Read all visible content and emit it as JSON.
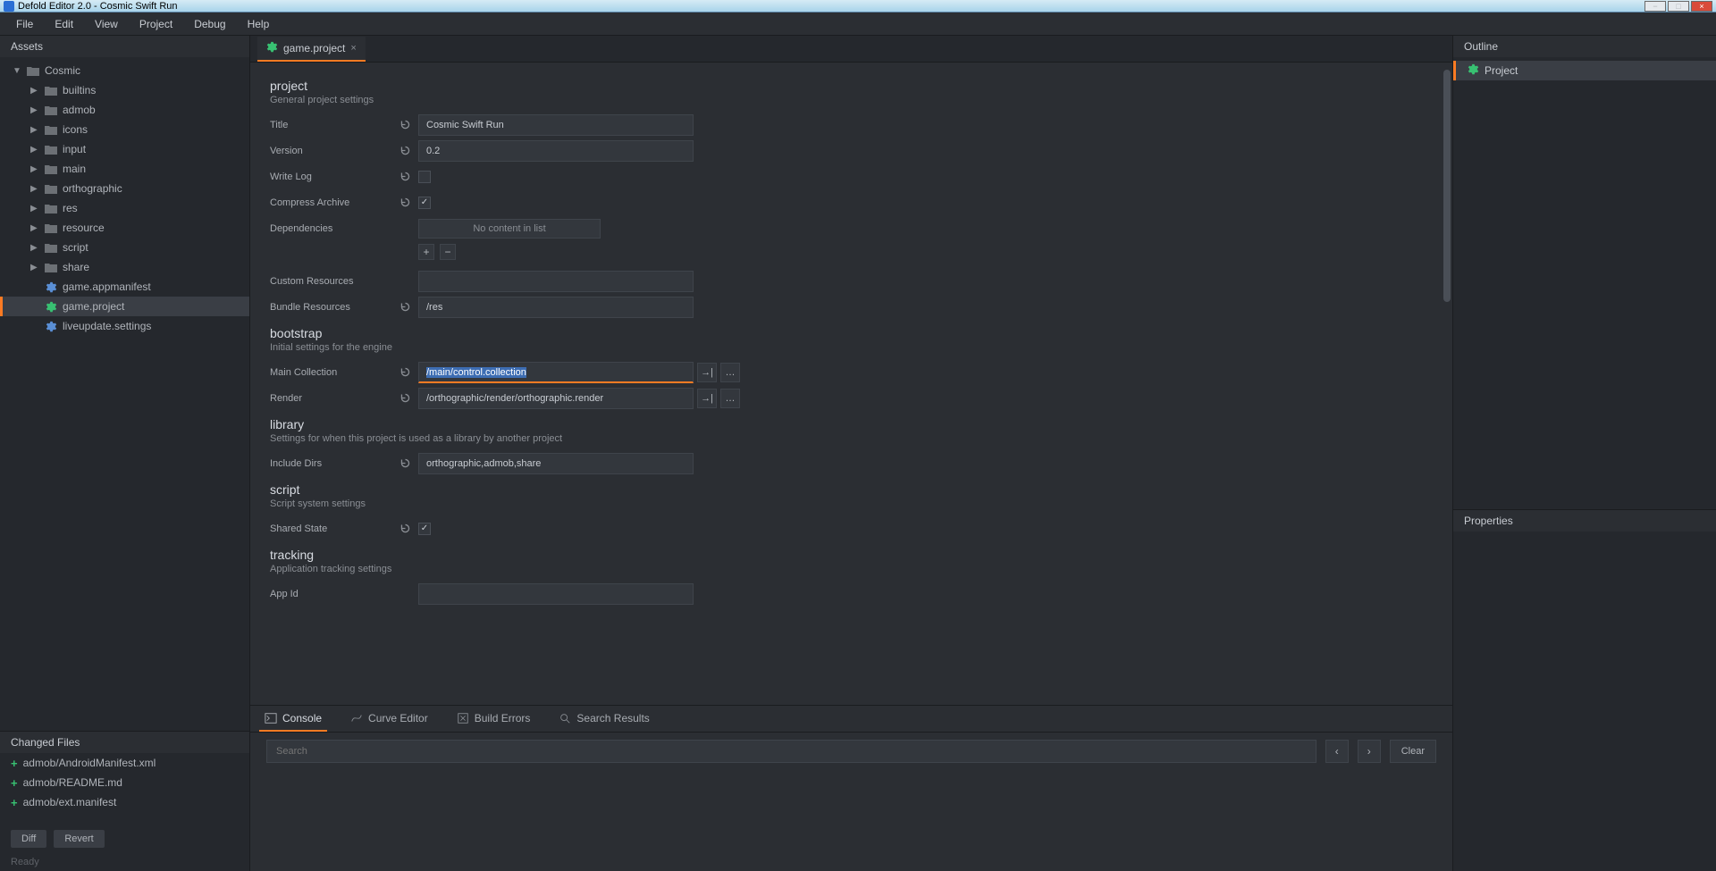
{
  "window": {
    "title": "Defold Editor 2.0 - Cosmic Swift Run",
    "minimize": "−",
    "maximize": "□",
    "close": "×"
  },
  "menubar": [
    "File",
    "Edit",
    "View",
    "Project",
    "Debug",
    "Help"
  ],
  "assets": {
    "header": "Assets",
    "root": "Cosmic",
    "folders": [
      "builtins",
      "admob",
      "icons",
      "input",
      "main",
      "orthographic",
      "res",
      "resource",
      "script",
      "share"
    ],
    "files": [
      {
        "name": "game.appmanifest",
        "iconColor": "#5a8fd6"
      },
      {
        "name": "game.project",
        "iconColor": "#38c172",
        "active": true
      },
      {
        "name": "liveupdate.settings",
        "iconColor": "#5a8fd6"
      }
    ]
  },
  "changed": {
    "header": "Changed Files",
    "files": [
      "admob/AndroidManifest.xml",
      "admob/README.md",
      "admob/ext.manifest"
    ],
    "diff": "Diff",
    "revert": "Revert"
  },
  "status": "Ready",
  "tab": {
    "label": "game.project"
  },
  "settings": {
    "sections": {
      "project": {
        "title": "project",
        "desc": "General project settings",
        "title_label": "Title",
        "title_value": "Cosmic Swift Run",
        "version_label": "Version",
        "version_value": "0.2",
        "writelog_label": "Write Log",
        "compress_label": "Compress Archive",
        "deps_label": "Dependencies",
        "deps_empty": "No content in list",
        "customres_label": "Custom Resources",
        "bundleres_label": "Bundle Resources",
        "bundleres_value": "/res"
      },
      "bootstrap": {
        "title": "bootstrap",
        "desc": "Initial settings for the engine",
        "maincol_label": "Main Collection",
        "maincol_value": "/main/control.collection",
        "render_label": "Render",
        "render_value": "/orthographic/render/orthographic.render"
      },
      "library": {
        "title": "library",
        "desc": "Settings for when this project is used as a library by another project",
        "include_label": "Include Dirs",
        "include_value": "orthographic,admob,share"
      },
      "script": {
        "title": "script",
        "desc": "Script system settings",
        "shared_label": "Shared State"
      },
      "tracking": {
        "title": "tracking",
        "desc": "Application tracking settings",
        "appid_label": "App Id"
      }
    }
  },
  "bottom": {
    "console": "Console",
    "curve": "Curve Editor",
    "builderrors": "Build Errors",
    "searchresults": "Search Results",
    "search_placeholder": "Search",
    "clear": "Clear"
  },
  "outline": {
    "header": "Outline",
    "item": "Project"
  },
  "properties": {
    "header": "Properties"
  }
}
